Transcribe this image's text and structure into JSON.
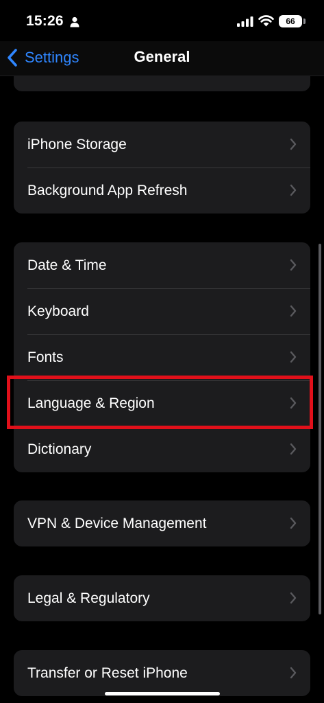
{
  "status_bar": {
    "time": "15:26",
    "battery": "66"
  },
  "nav": {
    "back_label": "Settings",
    "title": "General"
  },
  "groups": [
    {
      "items": [
        {
          "label": "iPhone Storage"
        },
        {
          "label": "Background App Refresh"
        }
      ]
    },
    {
      "items": [
        {
          "label": "Date & Time"
        },
        {
          "label": "Keyboard"
        },
        {
          "label": "Fonts"
        },
        {
          "label": "Language & Region"
        },
        {
          "label": "Dictionary"
        }
      ]
    },
    {
      "items": [
        {
          "label": "VPN & Device Management"
        }
      ]
    },
    {
      "items": [
        {
          "label": "Legal & Regulatory"
        }
      ]
    },
    {
      "items": [
        {
          "label": "Transfer or Reset iPhone"
        }
      ]
    }
  ],
  "colors": {
    "accent": "#2f86ff",
    "highlight": "#e0101a",
    "cell": "#1c1c1e",
    "background": "#000000"
  }
}
